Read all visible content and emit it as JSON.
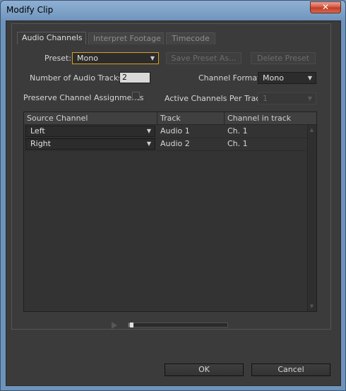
{
  "window": {
    "title": "Modify Clip",
    "close_glyph": "✕"
  },
  "tabs": [
    {
      "label": "Audio Channels",
      "active": true
    },
    {
      "label": "Interpret Footage",
      "active": false
    },
    {
      "label": "Timecode",
      "active": false
    }
  ],
  "preset": {
    "label": "Preset:",
    "value": "Mono",
    "save_label": "Save Preset As...",
    "delete_label": "Delete Preset"
  },
  "tracks": {
    "label": "Number of Audio Tracks:",
    "value": "2"
  },
  "channel_format": {
    "label": "Channel Format:",
    "value": "Mono"
  },
  "preserve": {
    "label": "Preserve Channel Assignments",
    "checked": false
  },
  "active_channels": {
    "label": "Active Channels Per Track:",
    "value": "1"
  },
  "table": {
    "headers": [
      "Source Channel",
      "Track",
      "Channel in track"
    ],
    "rows": [
      {
        "source": "Left",
        "track": "Audio  1",
        "channel": "Ch. 1"
      },
      {
        "source": "Right",
        "track": "Audio  2",
        "channel": "Ch. 1"
      }
    ]
  },
  "playback": {
    "progress": 0.03
  },
  "footer": {
    "ok_label": "OK",
    "cancel_label": "Cancel"
  },
  "icons": {
    "dropdown_arrow": "▼",
    "scroll_up": "▲",
    "scroll_down": "▼"
  }
}
